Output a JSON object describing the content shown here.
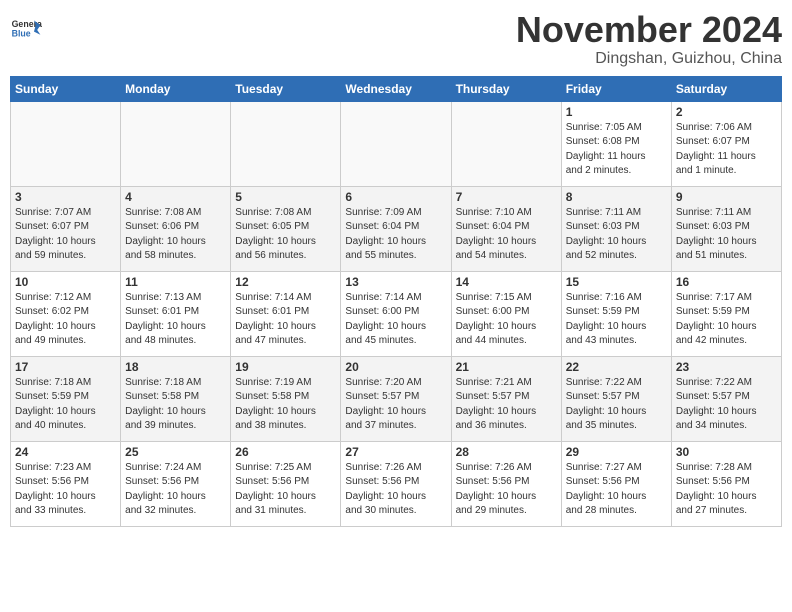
{
  "header": {
    "logo_line1": "General",
    "logo_line2": "Blue",
    "month": "November 2024",
    "location": "Dingshan, Guizhou, China"
  },
  "weekdays": [
    "Sunday",
    "Monday",
    "Tuesday",
    "Wednesday",
    "Thursday",
    "Friday",
    "Saturday"
  ],
  "weeks": [
    [
      {
        "day": "",
        "info": ""
      },
      {
        "day": "",
        "info": ""
      },
      {
        "day": "",
        "info": ""
      },
      {
        "day": "",
        "info": ""
      },
      {
        "day": "",
        "info": ""
      },
      {
        "day": "1",
        "info": "Sunrise: 7:05 AM\nSunset: 6:08 PM\nDaylight: 11 hours\nand 2 minutes."
      },
      {
        "day": "2",
        "info": "Sunrise: 7:06 AM\nSunset: 6:07 PM\nDaylight: 11 hours\nand 1 minute."
      }
    ],
    [
      {
        "day": "3",
        "info": "Sunrise: 7:07 AM\nSunset: 6:07 PM\nDaylight: 10 hours\nand 59 minutes."
      },
      {
        "day": "4",
        "info": "Sunrise: 7:08 AM\nSunset: 6:06 PM\nDaylight: 10 hours\nand 58 minutes."
      },
      {
        "day": "5",
        "info": "Sunrise: 7:08 AM\nSunset: 6:05 PM\nDaylight: 10 hours\nand 56 minutes."
      },
      {
        "day": "6",
        "info": "Sunrise: 7:09 AM\nSunset: 6:04 PM\nDaylight: 10 hours\nand 55 minutes."
      },
      {
        "day": "7",
        "info": "Sunrise: 7:10 AM\nSunset: 6:04 PM\nDaylight: 10 hours\nand 54 minutes."
      },
      {
        "day": "8",
        "info": "Sunrise: 7:11 AM\nSunset: 6:03 PM\nDaylight: 10 hours\nand 52 minutes."
      },
      {
        "day": "9",
        "info": "Sunrise: 7:11 AM\nSunset: 6:03 PM\nDaylight: 10 hours\nand 51 minutes."
      }
    ],
    [
      {
        "day": "10",
        "info": "Sunrise: 7:12 AM\nSunset: 6:02 PM\nDaylight: 10 hours\nand 49 minutes."
      },
      {
        "day": "11",
        "info": "Sunrise: 7:13 AM\nSunset: 6:01 PM\nDaylight: 10 hours\nand 48 minutes."
      },
      {
        "day": "12",
        "info": "Sunrise: 7:14 AM\nSunset: 6:01 PM\nDaylight: 10 hours\nand 47 minutes."
      },
      {
        "day": "13",
        "info": "Sunrise: 7:14 AM\nSunset: 6:00 PM\nDaylight: 10 hours\nand 45 minutes."
      },
      {
        "day": "14",
        "info": "Sunrise: 7:15 AM\nSunset: 6:00 PM\nDaylight: 10 hours\nand 44 minutes."
      },
      {
        "day": "15",
        "info": "Sunrise: 7:16 AM\nSunset: 5:59 PM\nDaylight: 10 hours\nand 43 minutes."
      },
      {
        "day": "16",
        "info": "Sunrise: 7:17 AM\nSunset: 5:59 PM\nDaylight: 10 hours\nand 42 minutes."
      }
    ],
    [
      {
        "day": "17",
        "info": "Sunrise: 7:18 AM\nSunset: 5:59 PM\nDaylight: 10 hours\nand 40 minutes."
      },
      {
        "day": "18",
        "info": "Sunrise: 7:18 AM\nSunset: 5:58 PM\nDaylight: 10 hours\nand 39 minutes."
      },
      {
        "day": "19",
        "info": "Sunrise: 7:19 AM\nSunset: 5:58 PM\nDaylight: 10 hours\nand 38 minutes."
      },
      {
        "day": "20",
        "info": "Sunrise: 7:20 AM\nSunset: 5:57 PM\nDaylight: 10 hours\nand 37 minutes."
      },
      {
        "day": "21",
        "info": "Sunrise: 7:21 AM\nSunset: 5:57 PM\nDaylight: 10 hours\nand 36 minutes."
      },
      {
        "day": "22",
        "info": "Sunrise: 7:22 AM\nSunset: 5:57 PM\nDaylight: 10 hours\nand 35 minutes."
      },
      {
        "day": "23",
        "info": "Sunrise: 7:22 AM\nSunset: 5:57 PM\nDaylight: 10 hours\nand 34 minutes."
      }
    ],
    [
      {
        "day": "24",
        "info": "Sunrise: 7:23 AM\nSunset: 5:56 PM\nDaylight: 10 hours\nand 33 minutes."
      },
      {
        "day": "25",
        "info": "Sunrise: 7:24 AM\nSunset: 5:56 PM\nDaylight: 10 hours\nand 32 minutes."
      },
      {
        "day": "26",
        "info": "Sunrise: 7:25 AM\nSunset: 5:56 PM\nDaylight: 10 hours\nand 31 minutes."
      },
      {
        "day": "27",
        "info": "Sunrise: 7:26 AM\nSunset: 5:56 PM\nDaylight: 10 hours\nand 30 minutes."
      },
      {
        "day": "28",
        "info": "Sunrise: 7:26 AM\nSunset: 5:56 PM\nDaylight: 10 hours\nand 29 minutes."
      },
      {
        "day": "29",
        "info": "Sunrise: 7:27 AM\nSunset: 5:56 PM\nDaylight: 10 hours\nand 28 minutes."
      },
      {
        "day": "30",
        "info": "Sunrise: 7:28 AM\nSunset: 5:56 PM\nDaylight: 10 hours\nand 27 minutes."
      }
    ]
  ]
}
